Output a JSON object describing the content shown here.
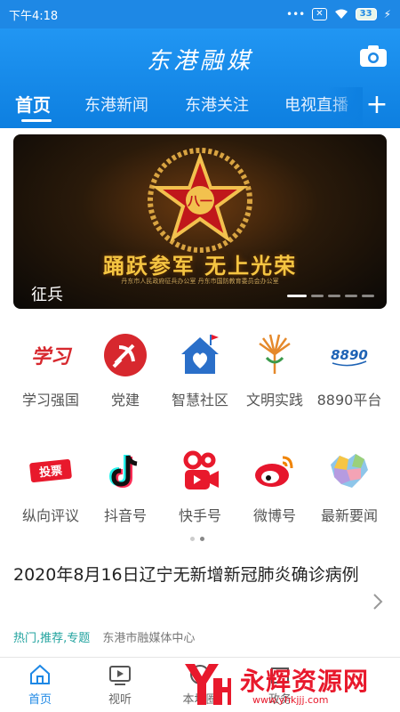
{
  "status": {
    "time": "下午4:18",
    "dots": "•••",
    "battery": "33"
  },
  "header": {
    "logo": "东港融媒",
    "tabs": [
      "首页",
      "东港新闻",
      "东港关注",
      "电视直播"
    ],
    "active_tab": 0
  },
  "banner": {
    "title": "踊跃参军 无上光荣",
    "caption": "征兵",
    "emblem_text": "八一",
    "small_print": "丹东市人民政府征兵办公室  丹东市国防教育委员会办公室"
  },
  "shortcuts_row1": [
    {
      "label": "学习强国",
      "icon": "xuexi-icon"
    },
    {
      "label": "党建",
      "icon": "party-emblem-icon"
    },
    {
      "label": "智慧社区",
      "icon": "smart-community-icon"
    },
    {
      "label": "文明实践",
      "icon": "civilization-icon"
    },
    {
      "label": "8890平台",
      "icon": "8890-icon"
    }
  ],
  "shortcuts_row2": [
    {
      "label": "纵向评议",
      "icon": "vote-icon",
      "badge": "投票"
    },
    {
      "label": "抖音号",
      "icon": "douyin-icon"
    },
    {
      "label": "快手号",
      "icon": "kuaishou-icon"
    },
    {
      "label": "微博号",
      "icon": "weibo-icon"
    },
    {
      "label": "最新要闻",
      "icon": "map-icon"
    }
  ],
  "icon_texts": {
    "xuexi": "学习",
    "platform": "8890"
  },
  "news": {
    "title": "2020年8月16日辽宁无新增新冠肺炎确诊病例",
    "tags": "热门,推荐,专题",
    "source": "东港市融媒体中心"
  },
  "bottom_nav": [
    "首页",
    "视听",
    "本地圈",
    "政务"
  ],
  "watermark": {
    "cn": "永辉资源网",
    "url": "www.yhkjjj.com"
  },
  "colors": {
    "brand": "#1e88e5",
    "accent_red": "#e8192c"
  }
}
